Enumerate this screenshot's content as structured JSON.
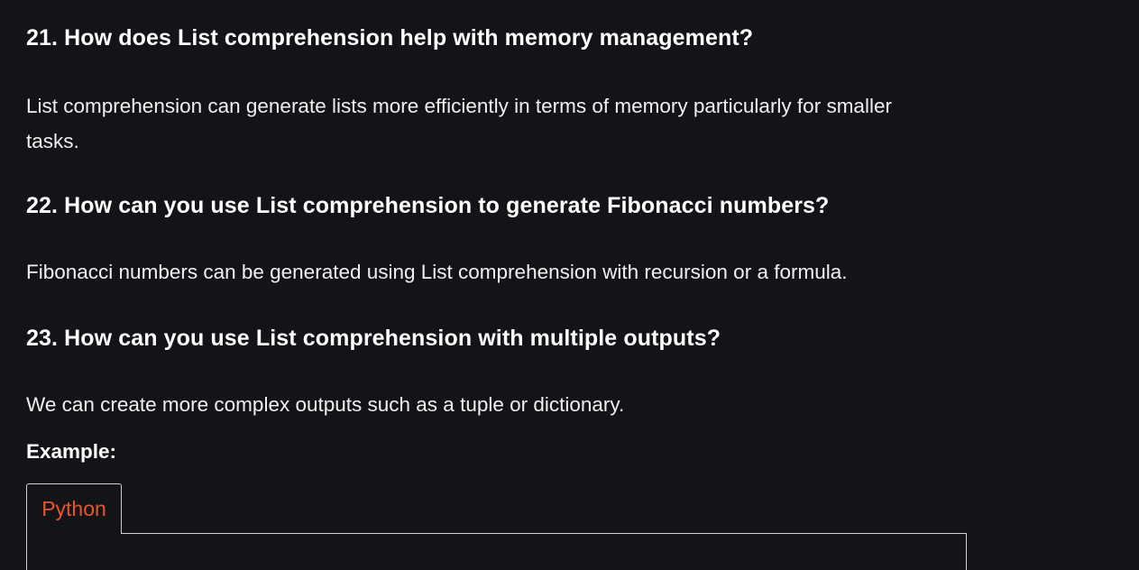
{
  "sections": [
    {
      "heading": "21. How does List comprehension help with memory management?",
      "answer": "List comprehension can generate lists more efficiently in terms of memory particularly for smaller tasks."
    },
    {
      "heading": "22. How can you use List comprehension to generate Fibonacci numbers?",
      "answer": "Fibonacci numbers can be generated using List comprehension with recursion or a formula."
    },
    {
      "heading": "23. How can you use List comprehension with multiple outputs?",
      "answer": "We can create more complex outputs such as a tuple or dictionary."
    }
  ],
  "example": {
    "label": "Example:"
  },
  "code_block": {
    "tabs": [
      "Python"
    ],
    "active_tab_color": "#e8562a"
  },
  "colors": {
    "background": "#131417",
    "text": "#f2f2f2",
    "tab_border": "#d0d0d0"
  }
}
